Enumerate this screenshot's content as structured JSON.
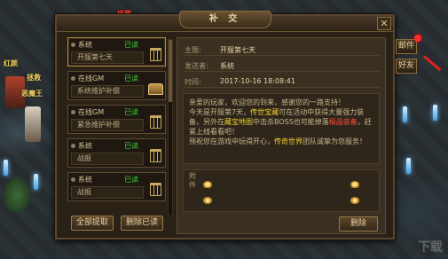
{
  "dialog": {
    "title": "补 交",
    "close_symbol": "✕"
  },
  "background": {
    "labels": [
      "红颜",
      "拯救",
      "楼霞",
      "恶魔王"
    ]
  },
  "mail_list": [
    {
      "sender": "系统",
      "status": "已读",
      "subject": "开服第七天",
      "icon": "trash-icon",
      "selected": true
    },
    {
      "sender": "在线GM",
      "status": "已读",
      "subject": "系统维护补偿",
      "icon": "chest-icon",
      "selected": false
    },
    {
      "sender": "在线GM",
      "status": "已读",
      "subject": "紧急维护补偿",
      "icon": "trash-icon",
      "selected": false
    },
    {
      "sender": "系统",
      "status": "已读",
      "subject": "战报",
      "icon": "trash-icon",
      "selected": false
    },
    {
      "sender": "系统",
      "status": "已读",
      "subject": "战报",
      "icon": "trash-icon",
      "selected": false
    }
  ],
  "buttons": {
    "collect_all": "全部提取",
    "delete_read": "删除已读",
    "delete": "删除"
  },
  "detail": {
    "subject_label": "主题:",
    "subject": "开服第七天",
    "sender_label": "发送者:",
    "sender": "系统",
    "time_label": "时间:",
    "time": "2017-10-16 18:08:41",
    "body": {
      "p1": "亲爱的玩家，欢迎您的到来，感谢您的一路支持！",
      "p2a": "今天是开服第7天，",
      "p2b": "传世宝藏",
      "p2c": "可在活动中获得大量强力装备，另外在",
      "p2d": "藏宝地图",
      "p2e": "中击杀BOSS也可能掉落",
      "p2f": "极品装备",
      "p2g": "，赶紧上线看看吧！",
      "p3a": "预祝您在游戏中玩得开心，",
      "p3b": "传奇世界",
      "p3c": "团队诚挚为您服务！"
    },
    "attachment_label": "附件"
  },
  "side_tabs": {
    "mail": "邮件",
    "friends": "好友"
  },
  "watermark": "下载"
}
